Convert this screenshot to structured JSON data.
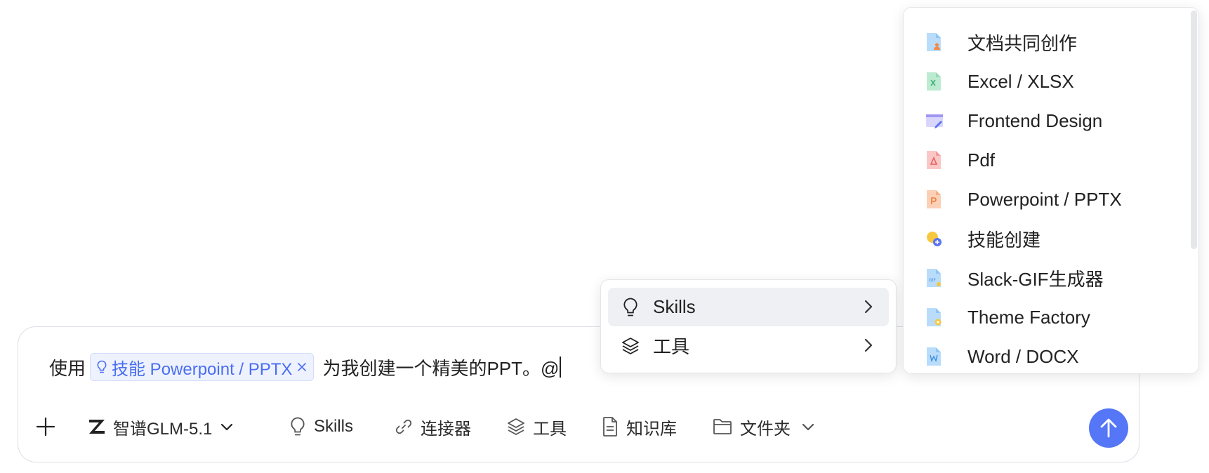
{
  "composer": {
    "prefix": "使用",
    "chip": {
      "label": "技能 Powerpoint / PPTX"
    },
    "suffix": "为我创建一个精美的PPT。@"
  },
  "toolbar": {
    "model": "智谱GLM-5.1",
    "skills": "Skills",
    "connectors": "连接器",
    "tools": "工具",
    "knowledge": "知识库",
    "folder": "文件夹"
  },
  "main_menu": {
    "items": [
      {
        "label": "Skills",
        "active": true
      },
      {
        "label": "工具",
        "active": false
      }
    ]
  },
  "skills_menu": {
    "items": [
      {
        "label": "文档共同创作",
        "icon": "doc-coauthor-icon"
      },
      {
        "label": "Excel / XLSX",
        "icon": "excel-file-icon"
      },
      {
        "label": "Frontend Design",
        "icon": "frontend-design-icon"
      },
      {
        "label": "Pdf",
        "icon": "pdf-file-icon"
      },
      {
        "label": "Powerpoint / PPTX",
        "icon": "ppt-file-icon"
      },
      {
        "label": "技能创建",
        "icon": "skill-create-icon"
      },
      {
        "label": "Slack-GIF生成器",
        "icon": "gif-file-icon"
      },
      {
        "label": "Theme Factory",
        "icon": "theme-file-icon"
      },
      {
        "label": "Word / DOCX",
        "icon": "word-file-icon"
      }
    ]
  },
  "colors": {
    "accent": "#5576f6",
    "chip_bg": "#eef2fe",
    "chip_text": "#4a6ef0",
    "menu_active_bg": "#eef0f3"
  }
}
